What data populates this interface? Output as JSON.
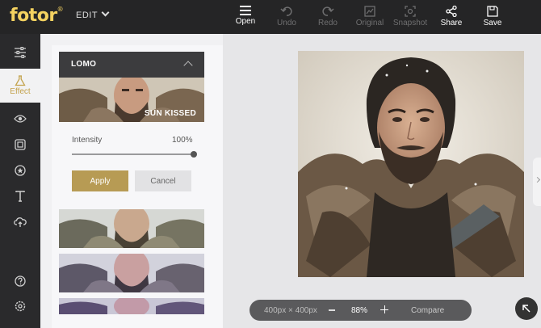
{
  "brand": {
    "logo_text": "fotor",
    "logo_mark": "®",
    "mode_label": "EDIT"
  },
  "toolbar": [
    {
      "label": "Open",
      "icon": "menu-icon",
      "enabled": true
    },
    {
      "label": "Undo",
      "icon": "undo-icon",
      "enabled": false
    },
    {
      "label": "Redo",
      "icon": "redo-icon",
      "enabled": false
    },
    {
      "label": "Original",
      "icon": "original-icon",
      "enabled": false
    },
    {
      "label": "Snapshot",
      "icon": "snapshot-icon",
      "enabled": false
    },
    {
      "label": "Share",
      "icon": "share-icon",
      "enabled": true
    },
    {
      "label": "Save",
      "icon": "save-icon",
      "enabled": true
    }
  ],
  "sidebar": {
    "items": [
      {
        "name": "adjust-icon"
      },
      {
        "name": "effect-icon",
        "label": "Effect",
        "active": true
      },
      {
        "name": "eye-icon"
      },
      {
        "name": "frame-icon"
      },
      {
        "name": "sticker-icon"
      },
      {
        "name": "text-icon"
      },
      {
        "name": "cloud-icon"
      },
      {
        "name": "help-icon"
      },
      {
        "name": "settings-icon"
      }
    ]
  },
  "effects_panel": {
    "category": "LOMO",
    "selected_effect": "SUN KISSED",
    "intensity_label": "Intensity",
    "intensity_value": "100%",
    "intensity_fraction": 1.0,
    "apply_label": "Apply",
    "cancel_label": "Cancel"
  },
  "canvas": {
    "dimensions": "400px × 400px",
    "zoom": "88%",
    "compare_label": "Compare"
  },
  "colors": {
    "accent": "#b79b54",
    "logo": "#f4d260",
    "topbar": "#252526",
    "rail": "#2a2a2c"
  }
}
